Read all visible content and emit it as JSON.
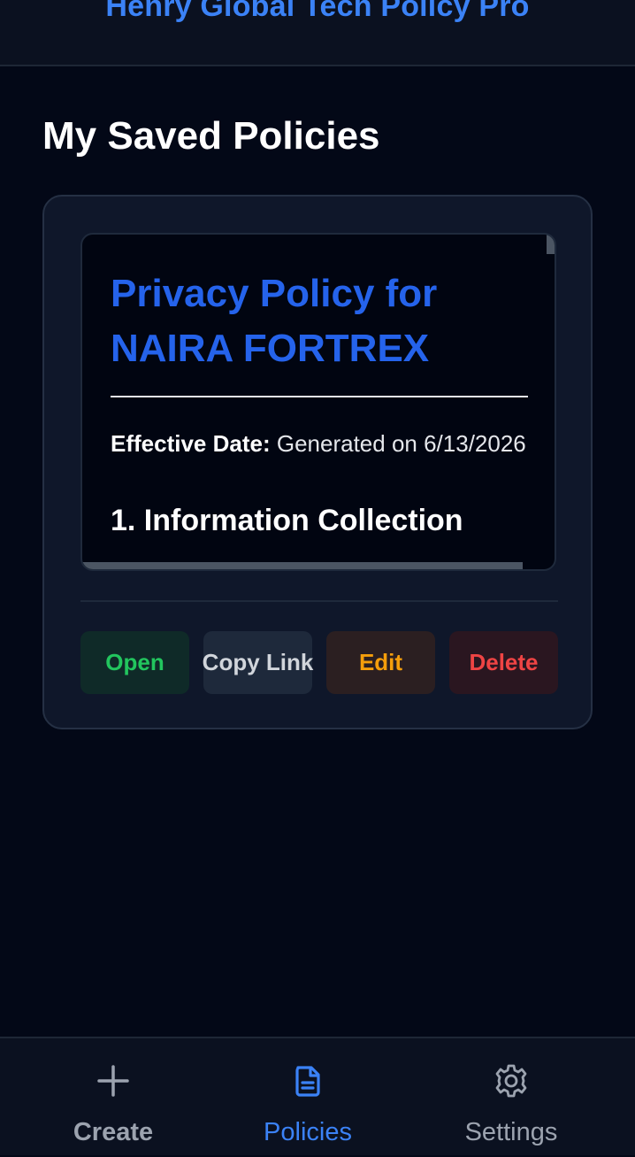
{
  "app": {
    "title": "Henry Global Tech Policy Pro"
  },
  "page": {
    "title": "My Saved Policies"
  },
  "policies": [
    {
      "preview": {
        "heading": "Privacy Policy for NAIRA FORTREX",
        "effective_date_label": "Effective Date:",
        "effective_date_value": "Generated on 6/13/2026",
        "section_heading": "1. Information Collection"
      },
      "actions": {
        "open": "Open",
        "copy_link": "Copy Link",
        "edit": "Edit",
        "delete": "Delete"
      }
    }
  ],
  "nav": {
    "items": [
      {
        "label": "Create",
        "icon": "plus-icon",
        "active": false
      },
      {
        "label": "Policies",
        "icon": "document-icon",
        "active": true
      },
      {
        "label": "Settings",
        "icon": "gear-icon",
        "active": false
      }
    ]
  },
  "colors": {
    "accent": "#3b82f6",
    "background": "#030817",
    "open": "#22c55e",
    "edit": "#f59e0b",
    "delete": "#ef4444"
  }
}
